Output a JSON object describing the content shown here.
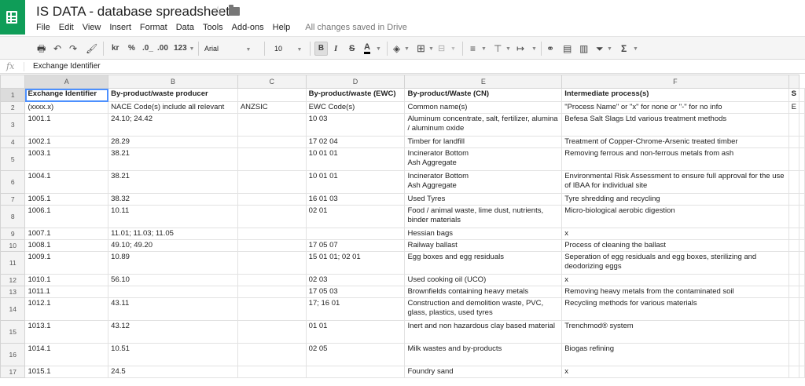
{
  "app": {
    "title": "IS DATA - database spreadsheet",
    "save_status": "All changes saved in Drive",
    "brand_color": "#0f9d58",
    "selection_color": "#4d90fe"
  },
  "menu": [
    "File",
    "Edit",
    "View",
    "Insert",
    "Format",
    "Data",
    "Tools",
    "Add-ons",
    "Help"
  ],
  "toolbar": {
    "format_kr": "kr",
    "format_percent": "%",
    "decimal_decrease": ".0_",
    "decimal_increase": ".00",
    "more_formats": "123",
    "font": "Arial",
    "font_size": "10",
    "bold": "B",
    "italic": "I",
    "strikethrough": "S",
    "text_color": "A",
    "sum": "Σ"
  },
  "formula_bar": {
    "fx": "fx",
    "value": "Exchange Identifier"
  },
  "columns": [
    "A",
    "B",
    "C",
    "D",
    "E",
    "F",
    "G"
  ],
  "rows": [
    {
      "n": "1",
      "cells": [
        "Exchange Identifier",
        "By-product/waste producer",
        "",
        "By-product/waste (EWC)",
        "By-product/Waste (CN)",
        "Intermediate process(s)",
        "S"
      ]
    },
    {
      "n": "2",
      "cells": [
        "(xxxx.x)",
        "NACE Code(s) include all relevant",
        "ANZSIC",
        "EWC Code(s)",
        "Common name(s)",
        "\"Process Name\" or \"x\" for none or \"-\" for no info",
        "E"
      ]
    },
    {
      "n": "3",
      "cells": [
        "1001.1",
        "24.10; 24.42",
        "",
        "10 03",
        "Aluminum concentrate, salt, fertilizer, alumina / aluminum oxide",
        "Befesa Salt Slags Ltd various treatment methods",
        ""
      ]
    },
    {
      "n": "4",
      "cells": [
        "1002.1",
        "28.29",
        "",
        "17 02 04",
        "Timber for landfill",
        "Treatment of Copper-Chrome-Arsenic treated timber",
        ""
      ]
    },
    {
      "n": "5",
      "cells": [
        "1003.1",
        "38.21",
        "",
        "10 01 01",
        "Incinerator Bottom\nAsh Aggregate",
        "Removing ferrous and non-ferrous metals from ash",
        ""
      ]
    },
    {
      "n": "6",
      "cells": [
        "1004.1",
        "38.21",
        "",
        "10 01 01",
        "Incinerator Bottom\nAsh Aggregate",
        "Environmental Risk Assessment to ensure full approval for the use of IBAA for individual site",
        ""
      ]
    },
    {
      "n": "7",
      "cells": [
        "1005.1",
        "38.32",
        "",
        "16 01 03",
        "Used Tyres",
        "Tyre shredding and recycling",
        ""
      ]
    },
    {
      "n": "8",
      "cells": [
        "1006.1",
        "10.11",
        "",
        "02 01",
        "Food / animal waste, lime dust, nutrients, binder materials",
        "Micro-biological aerobic digestion",
        ""
      ]
    },
    {
      "n": "9",
      "cells": [
        "1007.1",
        "11.01; 11.03; 11.05",
        "",
        "",
        "Hessian bags",
        "x",
        ""
      ]
    },
    {
      "n": "10",
      "cells": [
        "1008.1",
        "49.10; 49.20",
        "",
        "17 05 07",
        "Railway ballast",
        "Process of cleaning the ballast",
        ""
      ]
    },
    {
      "n": "11",
      "cells": [
        "1009.1",
        "10.89",
        "",
        "15 01 01; 02 01",
        "Egg boxes and egg residuals",
        "Seperation of egg residuals and egg boxes, sterilizing and deodorizing eggs",
        ""
      ]
    },
    {
      "n": "12",
      "cells": [
        "1010.1",
        "56.10",
        "",
        "02 03",
        "Used cooking oil (UCO)",
        "x",
        ""
      ]
    },
    {
      "n": "13",
      "cells": [
        "1011.1",
        "",
        "",
        "17 05 03",
        "Brownfields containing heavy metals",
        "Removing heavy metals from the contaminated soil",
        ""
      ]
    },
    {
      "n": "14",
      "cells": [
        "1012.1",
        "43.11",
        "",
        "17; 16 01",
        "Construction and demolition waste, PVC, glass, plastics, used tyres",
        "Recycling methods for various materials",
        ""
      ]
    },
    {
      "n": "15",
      "cells": [
        "1013.1",
        "43.12",
        "",
        "01 01",
        "Inert and non hazardous clay based material",
        "Trenchmod® system",
        ""
      ]
    },
    {
      "n": "16",
      "cells": [
        "1014.1",
        "10.51",
        "",
        "02 05",
        "Milk wastes and by-products",
        "Biogas refining",
        ""
      ]
    },
    {
      "n": "17",
      "cells": [
        "1015.1",
        "24.5",
        "",
        "",
        "Foundry sand",
        "x",
        ""
      ]
    }
  ]
}
